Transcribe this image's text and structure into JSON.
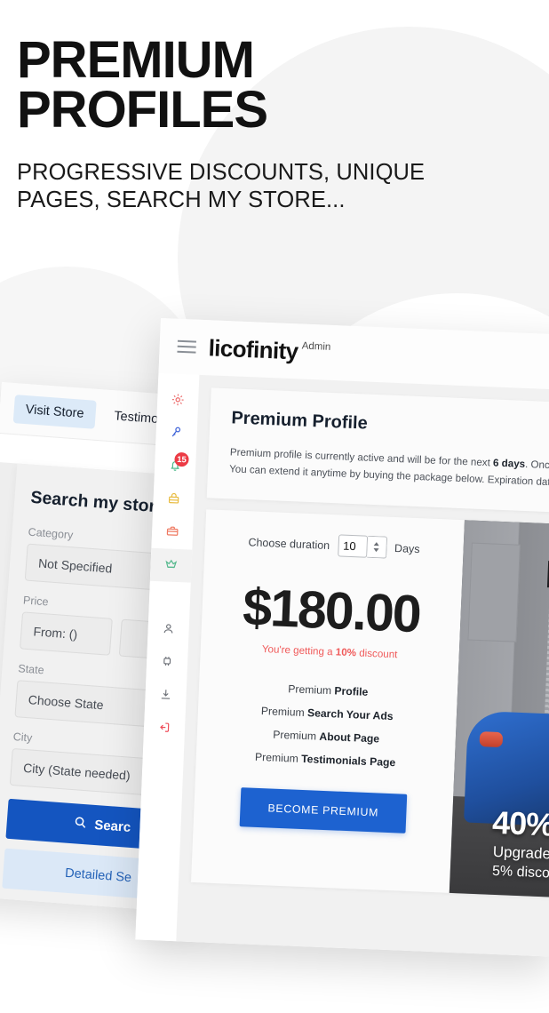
{
  "headline": {
    "line1": "PREMIUM",
    "line2": "PROFILES",
    "subtitle_line1": "PROGRESSIVE DISCOUNTS, UNIQUE",
    "subtitle_line2": "PAGES, SEARCH MY STORE..."
  },
  "store_card": {
    "tabs": [
      {
        "label": "Visit Store",
        "active": true
      },
      {
        "label": "Testimon",
        "active": false
      }
    ],
    "title": "Search my store",
    "fields": {
      "category_label": "Category",
      "category_value": "Not Specified",
      "price_label": "Price",
      "price_from_value": "From: ()",
      "state_label": "State",
      "state_value": "Choose State",
      "city_label": "City",
      "city_value": "City (State needed)"
    },
    "search_button": "Searc",
    "search_icon": "search-icon",
    "detailed_button": "Detailed Se"
  },
  "admin": {
    "menu_icon": "hamburger-icon",
    "brand": "licofinity",
    "brand_suffix": "Admin",
    "sidebar": [
      {
        "name": "sidebar-item-settings",
        "icon": "gear-icon",
        "glyph": "⚙",
        "color": "#ec6b6b",
        "badge": null,
        "active": false
      },
      {
        "name": "sidebar-item-keys",
        "icon": "key-icon",
        "glyph": "⚷",
        "color": "#3f63d8",
        "badge": null,
        "active": false
      },
      {
        "name": "sidebar-item-notifications",
        "icon": "bell-icon",
        "glyph": "␇",
        "color": "#4cb98a",
        "badge": "15",
        "active": false
      },
      {
        "name": "sidebar-item-packages",
        "icon": "lock-bag-icon",
        "glyph": "⬛",
        "color": "#e8bb3f",
        "badge": null,
        "active": false
      },
      {
        "name": "sidebar-item-business",
        "icon": "briefcase-icon",
        "glyph": "⬛",
        "color": "#ef7a62",
        "badge": null,
        "active": false
      },
      {
        "name": "sidebar-item-premium",
        "icon": "crown-icon",
        "glyph": "♛",
        "color": "#56b98e",
        "badge": null,
        "active": true
      },
      {
        "name": "sidebar-item-profile",
        "icon": "person-icon",
        "glyph": "○",
        "color": "#6b6f76",
        "badge": null,
        "active": false
      },
      {
        "name": "sidebar-item-integrations",
        "icon": "plug-icon",
        "glyph": "□",
        "color": "#6b6f76",
        "badge": null,
        "active": false
      },
      {
        "name": "sidebar-item-downloads",
        "icon": "download-icon",
        "glyph": "⤓",
        "color": "#6b6f76",
        "badge": null,
        "active": false
      },
      {
        "name": "sidebar-item-logout",
        "icon": "logout-icon",
        "glyph": "↦",
        "color": "#ef4e5a",
        "badge": null,
        "active": false
      }
    ],
    "panel": {
      "title": "Premium Profile",
      "desc_1": "Premium profile is currently active and will be for the next ",
      "desc_days": "6 days",
      "desc_2": ". Once it is ex",
      "desc_3": "You can extend it anytime by buying the package below. Expiration date woul"
    },
    "buy": {
      "duration_label": "Choose duration",
      "duration_value": "10",
      "duration_unit": "Days",
      "price": "$180.00",
      "discount_prefix": "You're getting a ",
      "discount_amount": "10%",
      "discount_suffix": " discount",
      "features": [
        {
          "prefix": "Premium ",
          "name": "Profile"
        },
        {
          "prefix": "Premium ",
          "name": "Search Your Ads"
        },
        {
          "prefix": "Premium ",
          "name": "About Page"
        },
        {
          "prefix": "Premium ",
          "name": "Testimonials Page"
        }
      ],
      "cta": "BECOME PREMIUM"
    },
    "promo": {
      "sign_text": "E",
      "big": "40%",
      "line1": "Upgrade",
      "line2": "5% disco"
    }
  },
  "colors": {
    "primary_blue": "#1455c0",
    "cta_blue": "#1d62d0",
    "tab_blue_bg": "#dceaf8",
    "discount_red": "#f05a5a",
    "badge_red": "#ec3b45"
  }
}
